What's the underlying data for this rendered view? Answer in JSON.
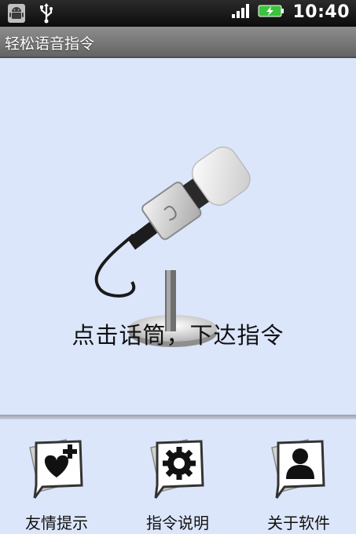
{
  "status_bar": {
    "time": "10:40",
    "icons": [
      "android-icon",
      "usb-icon",
      "signal-icon",
      "battery-charging-icon"
    ]
  },
  "app": {
    "title": "轻松语音指令"
  },
  "main": {
    "prompt": "点击话筒，下达指令",
    "microphone_icon": "microphone-icon"
  },
  "bottom_bar": {
    "buttons": [
      {
        "label": "友情提示",
        "icon": "heart-plus-icon"
      },
      {
        "label": "指令说明",
        "icon": "gear-icon"
      },
      {
        "label": "关于软件",
        "icon": "person-icon"
      }
    ]
  },
  "colors": {
    "background": "#dce6fb",
    "title_bar": "#7a7a7a",
    "status_bar": "#111111",
    "battery": "#3ec23e"
  }
}
